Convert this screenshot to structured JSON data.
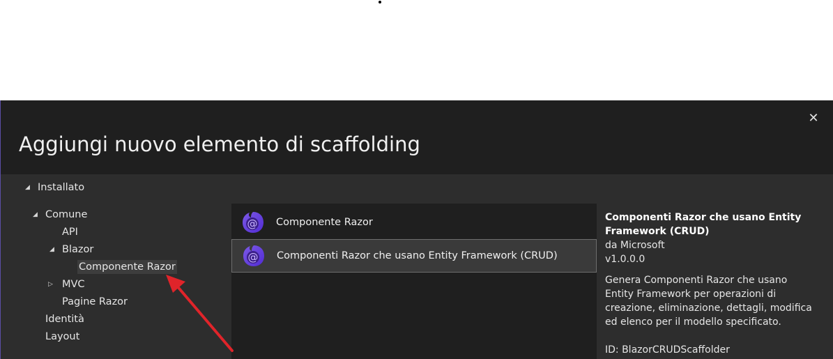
{
  "dialog": {
    "title": "Aggiungi nuovo elemento di scaffolding",
    "close_glyph": "✕"
  },
  "tree": {
    "installed": "Installato",
    "common": "Comune",
    "api": "API",
    "blazor": "Blazor",
    "razor_component": "Componente Razor",
    "mvc": "MVC",
    "razor_pages": "Pagine Razor",
    "identity": "Identità",
    "layout": "Layout"
  },
  "list": {
    "items": [
      {
        "label": "Componente Razor",
        "icon": "blazor-icon"
      },
      {
        "label": "Componenti Razor che usano Entity Framework (CRUD)",
        "icon": "blazor-icon"
      }
    ]
  },
  "details": {
    "name": "Componenti Razor che usano Entity Framework (CRUD)",
    "author": "da Microsoft",
    "version": "v1.0.0.0",
    "description": "Genera Componenti Razor che usano Entity Framework per operazioni di creazione, eliminazione, dettagli, modifica ed elenco per il modello specificato.",
    "id": "ID: BlazorCRUDScaffolder"
  },
  "colors": {
    "header_bg": "#1f1f1f",
    "panel_bg": "#2d2d2d",
    "accent_purple": "#6b3fd4",
    "annotation_red": "#e0242a"
  }
}
